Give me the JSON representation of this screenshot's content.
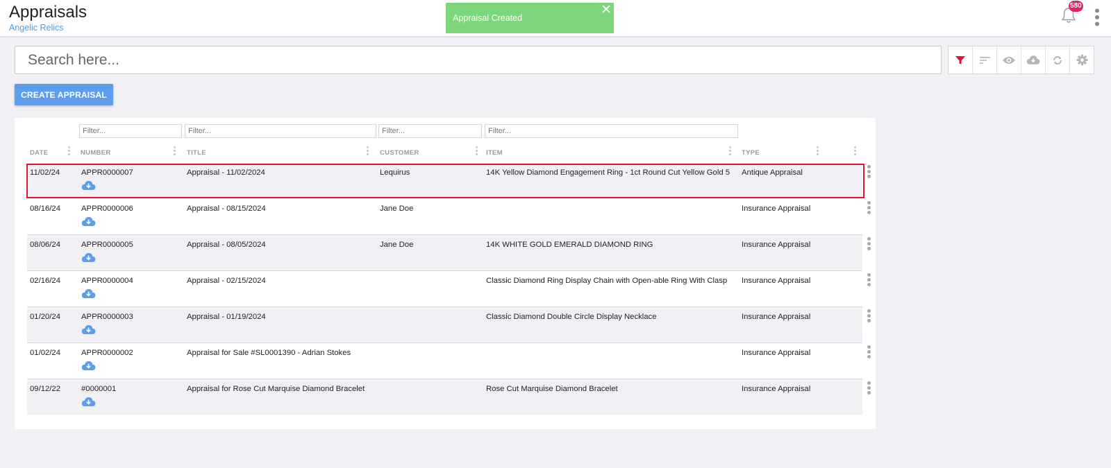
{
  "header": {
    "title": "Appraisals",
    "subtitle": "Angelic Relics"
  },
  "toast": {
    "message": "Appraisal Created"
  },
  "notifications": {
    "count": "580"
  },
  "search": {
    "placeholder": "Search here..."
  },
  "toolbar": {
    "icons": [
      "filter-icon",
      "sort-icon",
      "eye-icon",
      "cloud-download-icon",
      "refresh-icon",
      "gear-icon"
    ],
    "active_color": "#e0162b",
    "icon_color": "#b5b5bb"
  },
  "create_button": {
    "label": "CREATE APPRAISAL"
  },
  "table": {
    "filter_placeholder": "Filter...",
    "columns": [
      "DATE",
      "NUMBER",
      "TITLE",
      "CUSTOMER",
      "ITEM",
      "TYPE"
    ],
    "rows": [
      {
        "date": "11/02/24",
        "number": "APPR0000007",
        "title": "Appraisal - 11/02/2024",
        "customer": "Lequirus",
        "item": "14K Yellow Diamond Engagement Ring - 1ct Round Cut Yellow Gold 5",
        "type": "Antique Appraisal"
      },
      {
        "date": "08/16/24",
        "number": "APPR0000006",
        "title": "Appraisal - 08/15/2024",
        "customer": "Jane Doe",
        "item": "",
        "type": "Insurance Appraisal"
      },
      {
        "date": "08/06/24",
        "number": "APPR0000005",
        "title": "Appraisal - 08/05/2024",
        "customer": "Jane Doe",
        "item": "14K WHITE GOLD EMERALD DIAMOND RING",
        "type": "Insurance Appraisal"
      },
      {
        "date": "02/16/24",
        "number": "APPR0000004",
        "title": "Appraisal - 02/15/2024",
        "customer": "",
        "item": "Classic Diamond Ring Display Chain with Open-able Ring With Clasp",
        "type": "Insurance Appraisal"
      },
      {
        "date": "01/20/24",
        "number": "APPR0000003",
        "title": "Appraisal - 01/19/2024",
        "customer": "",
        "item": "Classic Diamond Double Circle Display Necklace",
        "type": "Insurance Appraisal"
      },
      {
        "date": "01/02/24",
        "number": "APPR0000002",
        "title": "Appraisal for Sale #SL0001390 - Adrian Stokes",
        "customer": "",
        "item": "",
        "type": "Insurance Appraisal"
      },
      {
        "date": "09/12/22",
        "number": "#0000001",
        "title": "Appraisal for Rose Cut Marquise Diamond Bracelet",
        "customer": "",
        "item": "Rose Cut Marquise Diamond Bracelet",
        "type": "Insurance Appraisal"
      }
    ]
  },
  "colors": {
    "accent_blue": "#5c9ded",
    "toast_green": "#7dd67c",
    "badge_pink": "#e91e63",
    "highlight_red": "#e0162b"
  }
}
